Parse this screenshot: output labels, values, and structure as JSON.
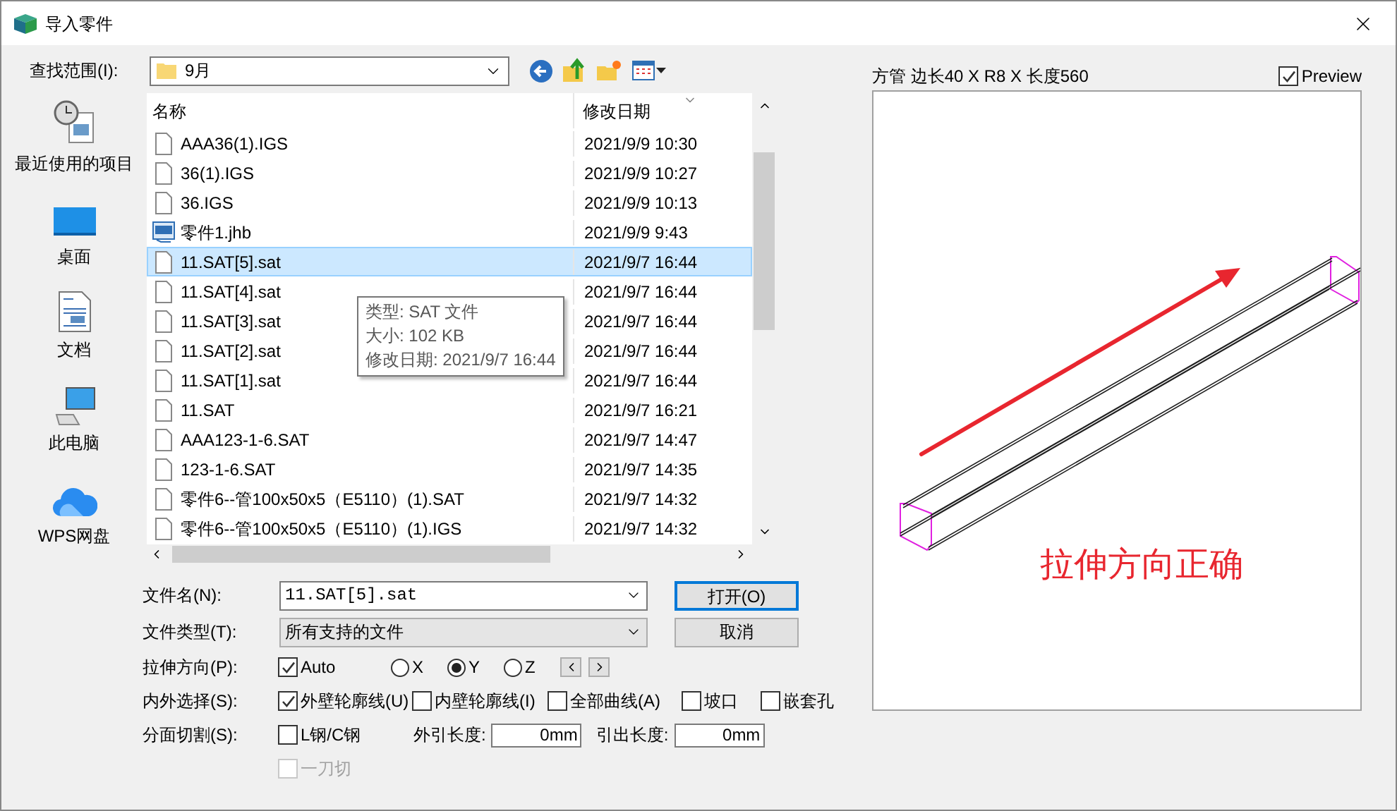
{
  "window": {
    "title": "导入零件"
  },
  "look_in": {
    "label": "查找范围(I):",
    "value": "9月"
  },
  "places": [
    {
      "kind": "recent",
      "label": "最近使用的项目"
    },
    {
      "kind": "desktop",
      "label": "桌面"
    },
    {
      "kind": "documents",
      "label": "文档"
    },
    {
      "kind": "computer",
      "label": "此电脑"
    },
    {
      "kind": "cloud",
      "label": "WPS网盘"
    }
  ],
  "file_list": {
    "columns": [
      "名称",
      "修改日期"
    ],
    "rows": [
      {
        "kind": "file",
        "name": "AAA36(1).IGS",
        "date": "2021/9/9 10:30",
        "selected": false
      },
      {
        "kind": "file",
        "name": "36(1).IGS",
        "date": "2021/9/9 10:27",
        "selected": false
      },
      {
        "kind": "file",
        "name": "36.IGS",
        "date": "2021/9/9 10:13",
        "selected": false
      },
      {
        "kind": "jhb",
        "name": "零件1.jhb",
        "date": "2021/9/9 9:43",
        "selected": false
      },
      {
        "kind": "file",
        "name": "11.SAT[5].sat",
        "date": "2021/9/7 16:44",
        "selected": true
      },
      {
        "kind": "file",
        "name": "11.SAT[4].sat",
        "date": "2021/9/7 16:44",
        "selected": false
      },
      {
        "kind": "file",
        "name": "11.SAT[3].sat",
        "date": "2021/9/7 16:44",
        "selected": false
      },
      {
        "kind": "file",
        "name": "11.SAT[2].sat",
        "date": "2021/9/7 16:44",
        "selected": false
      },
      {
        "kind": "file",
        "name": "11.SAT[1].sat",
        "date": "2021/9/7 16:44",
        "selected": false
      },
      {
        "kind": "file",
        "name": "11.SAT",
        "date": "2021/9/7 16:21",
        "selected": false
      },
      {
        "kind": "file",
        "name": "AAA123-1-6.SAT",
        "date": "2021/9/7 14:47",
        "selected": false
      },
      {
        "kind": "file",
        "name": "123-1-6.SAT",
        "date": "2021/9/7 14:35",
        "selected": false
      },
      {
        "kind": "file",
        "name": "零件6--管100x50x5（E5110）(1).SAT",
        "date": "2021/9/7 14:32",
        "selected": false
      },
      {
        "kind": "file",
        "name": "零件6--管100x50x5（E5110）(1).IGS",
        "date": "2021/9/7 14:32",
        "selected": false
      }
    ],
    "tooltip": [
      "类型: SAT 文件",
      "大小: 102 KB",
      "修改日期: 2021/9/7 16:44"
    ]
  },
  "file_name": {
    "label": "文件名(N):",
    "value": "11.SAT[5].sat"
  },
  "file_type": {
    "label": "文件类型(T):",
    "value": "所有支持的文件"
  },
  "buttons": {
    "open": "打开(O)",
    "cancel": "取消"
  },
  "direction": {
    "label": "拉伸方向(P):",
    "auto": {
      "label": "Auto",
      "checked": true
    },
    "axes": [
      {
        "label": "X",
        "selected": false
      },
      {
        "label": "Y",
        "selected": true
      },
      {
        "label": "Z",
        "selected": false
      }
    ]
  },
  "inner_outer": {
    "label": "内外选择(S):",
    "options": [
      {
        "label": "外壁轮廓线(U)",
        "checked": true
      },
      {
        "label": "内壁轮廓线(I)",
        "checked": false
      },
      {
        "label": "全部曲线(A)",
        "checked": false
      },
      {
        "label": "坡口",
        "checked": false
      },
      {
        "label": "嵌套孔",
        "checked": false
      }
    ]
  },
  "split": {
    "label": "分面切割(S):",
    "steel": {
      "label": "L钢/C钢",
      "checked": false,
      "disabled": false
    },
    "fields": [
      {
        "label": "外引长度:",
        "value": "0mm"
      },
      {
        "label": "引出长度:",
        "value": "0mm"
      }
    ],
    "one_cut": {
      "label": "一刀切",
      "checked": false,
      "disabled": true
    }
  },
  "preview": {
    "title": "方管 边长40 X R8 X 长度560",
    "toggle": {
      "label": "Preview",
      "checked": true
    },
    "caption": "拉伸方向正确"
  }
}
